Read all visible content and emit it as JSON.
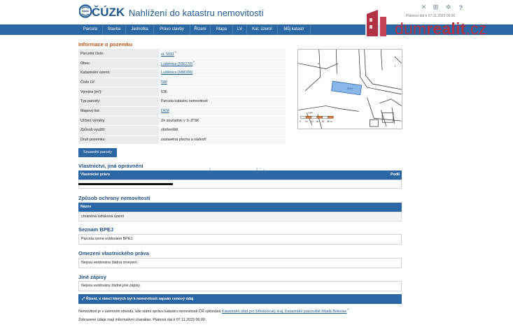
{
  "header": {
    "logo_text": "ČÚZK",
    "site_title": "Nahlížení do katastru nemovitostí",
    "validity_top": "Platnost dat k 07.11.2023 06:00",
    "icons": [
      "tools-icon",
      "cart-icon",
      "gear-icon",
      "help-icon"
    ]
  },
  "nav": [
    "Parcela",
    "Stavba",
    "Jednotka",
    "Právo stavby",
    "Řízení",
    "Mapa",
    "LV",
    "Kat. území",
    "Můj katastr"
  ],
  "watermark": {
    "text_plain": "dum",
    "text_bold": "realit",
    "text_tail": ".cz",
    "faint": "dumrealit.cz"
  },
  "pozemek": {
    "title": "Informace o pozemku",
    "rows": [
      {
        "label": "Parcelní číslo:",
        "value": "st. 5091",
        "link": true,
        "ext": true
      },
      {
        "label": "Obec:",
        "value": "Luštěnice [536270]",
        "link": true,
        "ext": true
      },
      {
        "label": "Katastrální území:",
        "value": "Luštěnice [688106]",
        "link": true,
        "ext": false
      },
      {
        "label": "Číslo LV:",
        "value": "590",
        "link": true,
        "ext": false
      },
      {
        "label": "Výměra [m²]:",
        "value": "636",
        "link": false,
        "ext": false
      },
      {
        "label": "Typ parcely:",
        "value": "Parcela katastru nemovitostí",
        "link": false,
        "ext": false
      },
      {
        "label": "Mapový list:",
        "value": "DKM",
        "link": true,
        "ext": false
      },
      {
        "label": "Určení výměry:",
        "value": "Ze souřadnic v S-JTSK",
        "link": false,
        "ext": false
      },
      {
        "label": "Způsob využití:",
        "value": "zbořeniště",
        "link": false,
        "ext": false
      },
      {
        "label": "Druh pozemku:",
        "value": "zastavěná plocha a nádvoří",
        "link": false,
        "ext": false
      }
    ]
  },
  "map": {
    "scale_labels": [
      "0",
      "10",
      "20",
      "30",
      "40",
      "50 m"
    ],
    "parcel_label": "5091",
    "label_1": "4",
    "label_2": "1/24"
  },
  "neighbors_button": "Sousední parcely",
  "vlastnici": {
    "title": "Vlastnictví, jiná oprávnění",
    "col1": "Vlastnické právo",
    "col2": "Podíl"
  },
  "ochrana": {
    "title": "Způsob ochrany nemovitosti",
    "header": "Název",
    "value": "chráněná ložisková území"
  },
  "bpej": {
    "title": "Seznam BPEJ",
    "value": "Parcela nemá evidované BPEJ."
  },
  "omezeni": {
    "title": "Omezení vlastnického práva",
    "value": "Nejsou evidována žádná omezení."
  },
  "zapisy": {
    "title": "Jiné zápisy",
    "value": "Nejsou evidovány žádné jiné zápisy."
  },
  "price_bar": "Řízení, v rámci kterých byl k nemovitosti zapsán cenový údaj",
  "footer": {
    "line1_text": "Nemovitost je v územním obvodu, kde státní správu katastru nemovitostí ČR vykonává",
    "line1_link": "Katastrální úřad pro Středočeský kraj, Katastrální pracoviště Mladá Boleslav",
    "line2": "Zobrazené údaje mají informativní charakter. Platnost dat k 07.11.2023 06:00."
  }
}
